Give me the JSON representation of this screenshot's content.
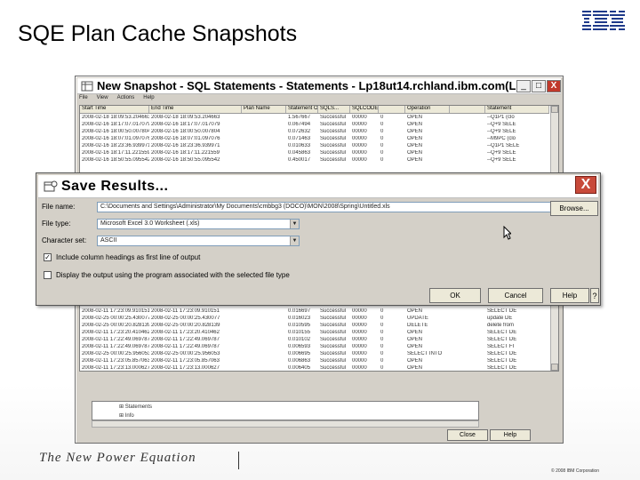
{
  "slide": {
    "title": "SQE Plan Cache Snapshots",
    "logo": "IBM",
    "tagline": "The New Power Equation",
    "copyright": "© 2008 IBM Corporation"
  },
  "snapshot_window": {
    "title": "New Snapshot - SQL Statements - Statements - Lp18ut14.rchland.ibm.com(Lp18ut...",
    "minimize": "_",
    "maximize": "□",
    "close": "X",
    "menu": [
      "File",
      "View",
      "Actions",
      "Help"
    ],
    "columns": [
      "Start Time",
      "End Time",
      "Plan Name",
      "Statement Outco...",
      "SQLS...",
      "SQLCODE",
      "",
      "Operation",
      "",
      "Statement"
    ],
    "top_rows": [
      [
        "2008-02-18 18:09:53.204663",
        "2008-02-18 18:09:53.204663",
        "",
        "1.567667",
        "Successful",
        "00000",
        "0",
        "OPEN",
        "",
        "--Q1P1 (clo"
      ],
      [
        "2008-02-16 18:17:07.017079",
        "2008-02-16 18:17:07.017079",
        "",
        "0.067494",
        "Successful",
        "00000",
        "0",
        "OPEN",
        "",
        "--Q+9 SELE"
      ],
      [
        "2008-02-16 18:00:50.007804",
        "2008-02-16 18:00:50.007804",
        "",
        "0.072632",
        "Successful",
        "00000",
        "0",
        "OPEN",
        "",
        "--Q+9 SELE"
      ],
      [
        "2008-02-16 18:07:01.097076",
        "2008-02-16 18:07:01.097076",
        "",
        "0.071463",
        "Successful",
        "00000",
        "0",
        "OPEN",
        "",
        "--M9PC (clo"
      ],
      [
        "2008-02-16 18:23:36.939971",
        "2008-02-16 18:23:36.939971",
        "",
        "0.010633",
        "Successful",
        "00000",
        "0",
        "OPEN",
        "",
        "--Q1P1 SELE"
      ],
      [
        "2008-02-16 18:17:11.221559",
        "2008-02-16 18:17:11.221559",
        "",
        "0.045863",
        "Successful",
        "00000",
        "0",
        "OPEN",
        "",
        "--Q+9 SELE"
      ],
      [
        "2008-02-16 18:50:55.095542",
        "2008-02-16 18:50:55.095542",
        "",
        "0.450017",
        "Successful",
        "00000",
        "0",
        "OPEN",
        "",
        "--Q+9 SELE"
      ]
    ],
    "bottom_rows": [
      [
        "2008-02-11 17:23:09.910151",
        "2008-02-11 17:23:09.910151",
        "",
        "0.016697",
        "Successful",
        "00000",
        "0",
        "OPEN",
        "",
        "SELECT DE"
      ],
      [
        "2008-02-25 00:00:25.430077",
        "2008-02-25 00:00:25.430077",
        "",
        "0.016023",
        "Successful",
        "00000",
        "0",
        "UPDATE",
        "",
        "update DE"
      ],
      [
        "2008-02-25 00:00:20.828139",
        "2008-02-25 00:00:20.828139",
        "",
        "0.010595",
        "Successful",
        "00000",
        "0",
        "DELETE",
        "",
        "delete from"
      ],
      [
        "2008-02-11 17:23:20.410462",
        "2008-02-11 17:23:20.410462",
        "",
        "0.010155",
        "Successful",
        "00000",
        "0",
        "OPEN",
        "",
        "SELECT DE"
      ],
      [
        "2008-02-11 17:22:49.069787",
        "2008-02-11 17:22:49.069787",
        "",
        "0.010102",
        "Successful",
        "00000",
        "0",
        "OPEN",
        "",
        "SELECT DE"
      ],
      [
        "2008-02-11 17:22:49.069787",
        "2008-02-11 17:22:49.069787",
        "",
        "0.006593",
        "Successful",
        "00000",
        "0",
        "OPEN",
        "",
        "SELECT FI"
      ],
      [
        "2008-02-25 00:00:25.956053",
        "2008-02-25 00:00:25.956053",
        "",
        "0.006695",
        "Successful",
        "00000",
        "0",
        "SELECT INTO",
        "",
        "SELECT DE"
      ],
      [
        "2008-02-11 17:23:05.857063",
        "2008-02-11 17:23:05.857063",
        "",
        "0.006863",
        "Successful",
        "00000",
        "0",
        "OPEN",
        "",
        "SELECT DE"
      ],
      [
        "2008-02-11 17:23:13.000627",
        "2008-02-11 17:23:13.000627",
        "",
        "0.006405",
        "Successful",
        "00000",
        "0",
        "OPEN",
        "",
        "SELECT DE"
      ]
    ],
    "tree_items": [
      "Statements",
      "Info"
    ],
    "close_button": "Close",
    "help_button": "Help"
  },
  "dialog": {
    "title": "Save Results...",
    "close": "X",
    "file_name_label": "File name:",
    "file_name_value": "C:\\Documents and Settings\\Administrator\\My Documents\\cmbbg3 (DOCO)\\MON\\2008\\Spring\\Untitled.xls",
    "browse_button": "Browse...",
    "file_type_label": "File type:",
    "file_type_value": "Microsoft Excel 3.0 Worksheet (.xls)",
    "charset_label": "Character set:",
    "charset_value": "ASCII",
    "include_headings_label": "Include column headings as first line of output",
    "include_headings_checked": true,
    "display_output_label": "Display the output using the program associated with the selected file type",
    "display_output_checked": false,
    "ok_button": "OK",
    "cancel_button": "Cancel",
    "help_button": "Help",
    "help_q": "?"
  }
}
